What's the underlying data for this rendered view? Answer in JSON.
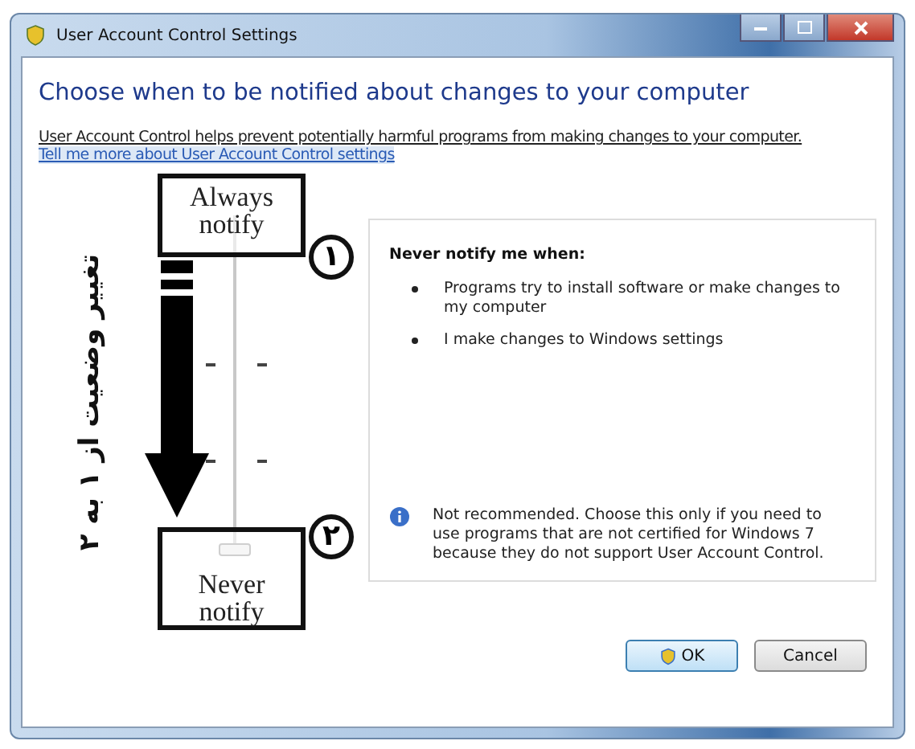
{
  "window": {
    "title": "User Account Control Settings"
  },
  "heading": "Choose when to be notified about changes to your computer",
  "description": "User Account Control helps prevent potentially harmful programs from making changes to your computer.",
  "link": "Tell me more about User Account Control settings",
  "slider": {
    "level": 0
  },
  "info_panel": {
    "title": "Never notify me when:",
    "bullets": [
      "Programs try to install software or make changes to my computer",
      "I make changes to Windows settings"
    ],
    "note": "Not recommended. Choose this only if you need to use programs that are not certified for Windows 7 because they do not support User Account Control."
  },
  "buttons": [
    {
      "label": "OK",
      "kind": "shield"
    },
    {
      "label": "Cancel",
      "kind": "plain"
    }
  ],
  "annotations": {
    "top_label": "Always notify",
    "bottom_label": "Never notify",
    "markers": [
      "۱",
      "۲"
    ],
    "caption": "تغییر وضعیت از ۱ به ۲"
  }
}
